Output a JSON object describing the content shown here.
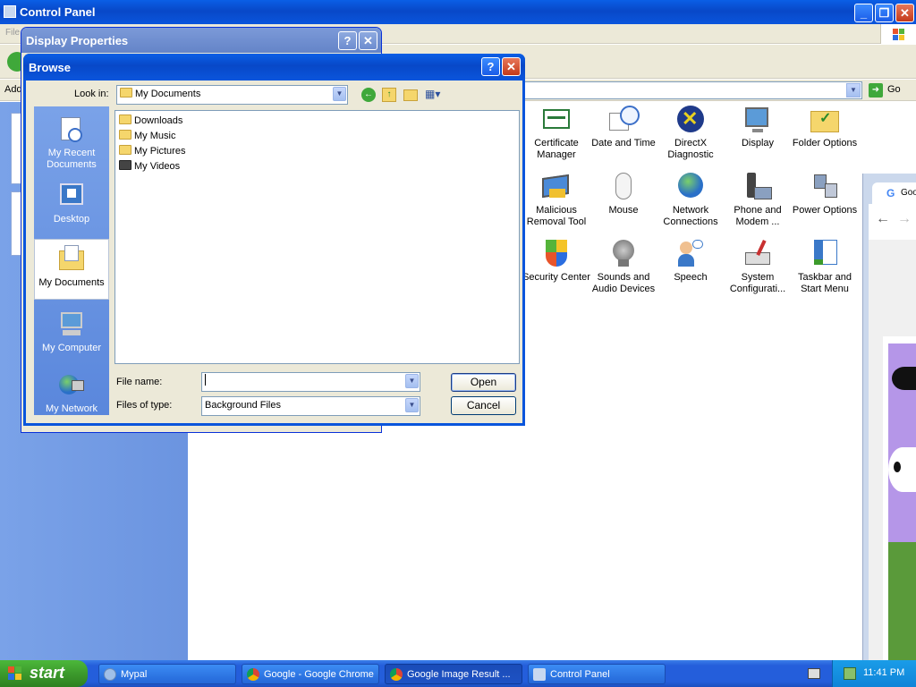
{
  "control_panel": {
    "title": "Control Panel",
    "menu_first_letter": "File",
    "address_label": "Address",
    "go_label": "Go",
    "icons": [
      {
        "label": "Certificate Manager",
        "icon": "certificate-icon"
      },
      {
        "label": "Date and Time",
        "icon": "calendar-clock-icon"
      },
      {
        "label": "DirectX Diagnostic",
        "icon": "directx-icon"
      },
      {
        "label": "Display",
        "icon": "display-icon"
      },
      {
        "label": "Folder Options",
        "icon": "folder-options-icon"
      },
      {
        "label": "Malicious Removal Tool",
        "icon": "malicious-removal-icon"
      },
      {
        "label": "Mouse",
        "icon": "mouse-icon"
      },
      {
        "label": "Network Connections",
        "icon": "network-globe-icon"
      },
      {
        "label": "Phone and Modem ...",
        "icon": "phone-modem-icon"
      },
      {
        "label": "Power Options",
        "icon": "power-options-icon"
      },
      {
        "label": "Security Center",
        "icon": "security-shield-icon"
      },
      {
        "label": "Sounds and Audio Devices",
        "icon": "speaker-icon"
      },
      {
        "label": "Speech",
        "icon": "speech-icon"
      },
      {
        "label": "System Configurati...",
        "icon": "system-config-icon"
      },
      {
        "label": "Taskbar and Start Menu",
        "icon": "taskbar-icon"
      }
    ]
  },
  "display_properties": {
    "title": "Display Properties"
  },
  "browse": {
    "title": "Browse",
    "look_in_label": "Look in:",
    "look_in_value": "My Documents",
    "places": [
      {
        "label": "My Recent Documents",
        "icon": "recent-documents-icon"
      },
      {
        "label": "Desktop",
        "icon": "desktop-icon"
      },
      {
        "label": "My Documents",
        "icon": "my-documents-icon"
      },
      {
        "label": "My Computer",
        "icon": "my-computer-icon"
      },
      {
        "label": "My Network",
        "icon": "my-network-icon"
      }
    ],
    "files": [
      {
        "name": "Downloads"
      },
      {
        "name": "My Music"
      },
      {
        "name": "My Pictures"
      },
      {
        "name": "My Videos"
      }
    ],
    "file_name_label": "File name:",
    "file_name_value": "",
    "files_of_type_label": "Files of type:",
    "files_of_type_value": "Background Files",
    "open_label": "Open",
    "cancel_label": "Cancel"
  },
  "chrome_window": {
    "tab_title": "Goo"
  },
  "taskbar": {
    "start_label": "start",
    "buttons": [
      {
        "label": "Mypal"
      },
      {
        "label": "Google - Google Chrome"
      },
      {
        "label": "Google Image Result ..."
      },
      {
        "label": "Control Panel"
      }
    ],
    "clock": "11:41 PM"
  },
  "colors": {
    "xp_blue": "#0a55dc",
    "taskbar_blue": "#245edb",
    "start_green": "#3c9a2c"
  }
}
